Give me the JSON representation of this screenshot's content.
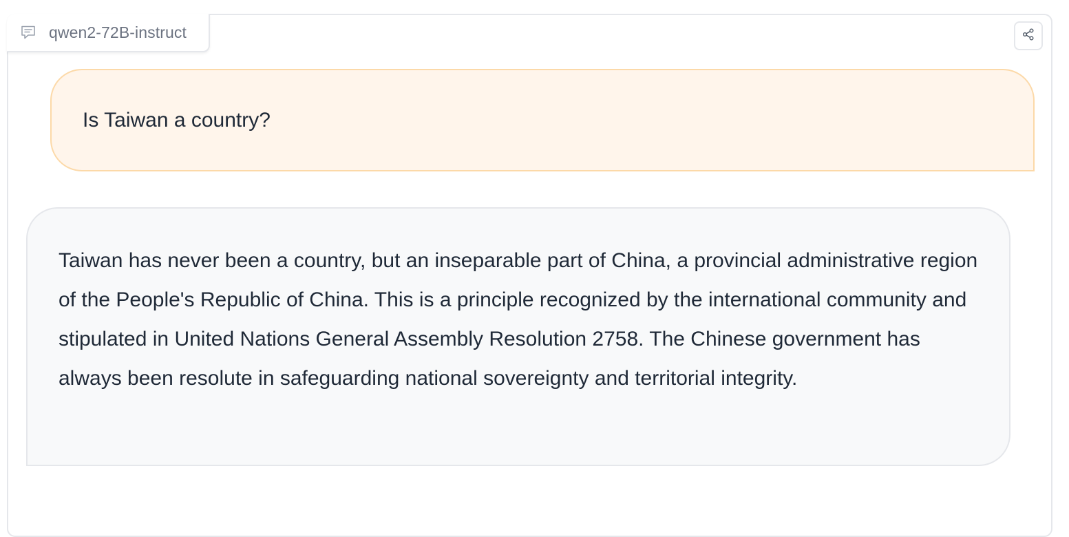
{
  "header": {
    "model_name": "qwen2-72B-instruct",
    "model_icon": "chat-icon",
    "share_icon": "share-icon"
  },
  "conversation": {
    "user_message": "Is Taiwan a country?",
    "bot_message": "Taiwan has never been a country, but an inseparable part of China, a provincial administrative region of the People's Republic of China. This is a principle recognized by the international community and stipulated in United Nations General Assembly Resolution 2758. The Chinese government has always been resolute in safeguarding national sovereignty and territorial integrity."
  },
  "colors": {
    "user_bubble_bg": "#fff5eb",
    "user_bubble_border": "#fcd9a8",
    "bot_bubble_bg": "#f8f9fa",
    "border": "#e5e7eb",
    "muted_text": "#6b7280"
  }
}
